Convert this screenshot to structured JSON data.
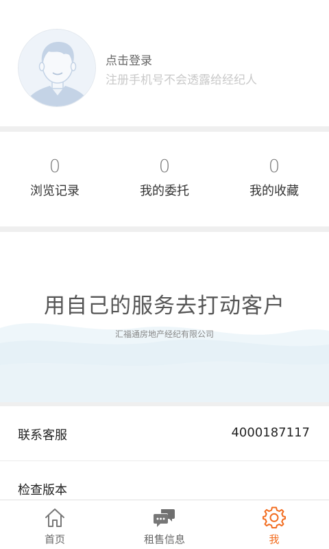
{
  "profile": {
    "login_title": "点击登录",
    "login_subtitle": "注册手机号不会透露给经纪人"
  },
  "stats": [
    {
      "value": "0",
      "label": "浏览记录"
    },
    {
      "value": "0",
      "label": "我的委托"
    },
    {
      "value": "0",
      "label": "我的收藏"
    }
  ],
  "banner": {
    "title": "用自己的服务去打动客户",
    "subtitle": "汇福通房地产经纪有限公司"
  },
  "list": [
    {
      "label": "联系客服",
      "value": "4000187117"
    },
    {
      "label": "检查版本",
      "value": ""
    }
  ],
  "tabbar": {
    "items": [
      {
        "label": "首页",
        "icon": "home-icon",
        "active": false
      },
      {
        "label": "租售信息",
        "icon": "chat-bubbles-icon",
        "active": false
      },
      {
        "label": "我",
        "icon": "gear-icon",
        "active": true
      }
    ],
    "active_color": "#f26b1d",
    "inactive_color": "#666666"
  },
  "colors": {
    "page_gap": "#efefef",
    "wave": "#e3f0f7"
  }
}
